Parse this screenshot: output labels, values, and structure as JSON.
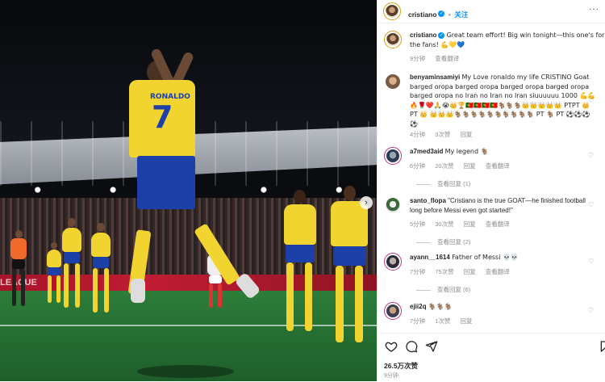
{
  "post": {
    "username": "cristiano",
    "follow_label": "关注",
    "separator": "•",
    "more_label": "···",
    "caption_user": "cristiano",
    "caption_text": "Great team effort! Big win tonight—this one's for the fans! 💪💛💙",
    "caption_time": "9分钟",
    "caption_translate": "查看翻译",
    "likes": "26.5万次赞",
    "posted_ago": "9分钟",
    "photo_board_text": "LEAGUE",
    "player_number": "7",
    "player_name": "RONALDO"
  },
  "comments": [
    {
      "user": "benyaminsamiyi",
      "text": "My Love ronaldo my life CRISTINO Goat barged oropa barged oropa barged oropa barged oropa barged oropa no Iran no Iran no Iran siuuuuuu 1000 💪💪🔥🌹❤️🙏😭👑🏆🇵🇹🇵🇹🇵🇹🇵🇹🐐🐐🐐👑👑👑👑👑 PTPT 👑 PT 👑 👑👑👑🐐🐐🐐🐐🐐🐐🐐🐐🐐🐐 PT 🐐 PT ⚽⚽⚽⚽",
      "time": "4分钟",
      "likes": "3次赞",
      "reply": "回复"
    },
    {
      "user": "a7med3aid",
      "text": "My legend 🐐",
      "time": "6分钟",
      "likes": "20次赞",
      "reply": "回复",
      "translate": "查看翻译",
      "view_replies": "查看回复 (1)"
    },
    {
      "user": "santo_flopa",
      "text": "\"Cristiano is the true GOAT—he finished football long before Messi even got started!\"",
      "time": "5分钟",
      "likes": "30次赞",
      "reply": "回复",
      "translate": "查看翻译",
      "view_replies": "查看回复 (2)"
    },
    {
      "user": "ayann__1614",
      "text": "Father of Messi 💀💀",
      "time": "7分钟",
      "likes": "75次赞",
      "reply": "回复",
      "translate": "查看翻译",
      "view_replies": "查看回复 (6)"
    },
    {
      "user": "ejii2q",
      "text": "🐐🐐🐐",
      "time": "7分钟",
      "likes": "1次赞",
      "reply": "回复"
    }
  ],
  "icons": {
    "like": "heart-icon",
    "comment": "comment-icon",
    "share": "share-icon",
    "save": "bookmark-icon"
  },
  "colors": {
    "accent": "#0095f6",
    "jersey": "#f2d431",
    "shorts": "#1c3fa8"
  }
}
